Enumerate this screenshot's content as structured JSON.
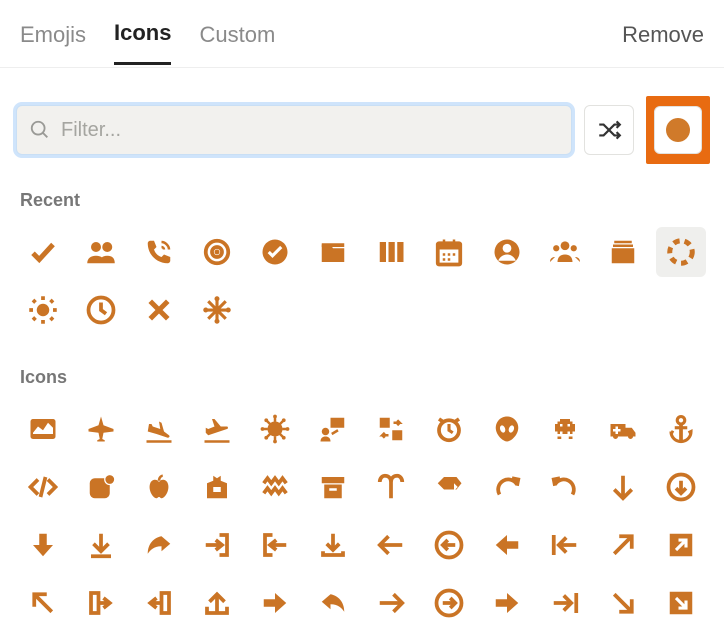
{
  "tabs": {
    "emojis": "Emojis",
    "icons": "Icons",
    "custom": "Custom",
    "active": "icons"
  },
  "remove_label": "Remove",
  "search": {
    "placeholder": "Filter...",
    "value": ""
  },
  "color": "#d07a2a",
  "sections": {
    "recent": "Recent",
    "icons": "Icons"
  },
  "recent_icons": [
    "check",
    "users",
    "phone-volume",
    "crosshair",
    "check-circle",
    "folder",
    "columns",
    "calendar",
    "user-circle",
    "users-group",
    "folder-stack",
    "dashed-circle",
    "sun",
    "clock",
    "x",
    "snowflake"
  ],
  "icons_grid": [
    "chart-area",
    "airplane",
    "plane-arrival",
    "plane-departure",
    "virus",
    "box-user",
    "box-swap",
    "alarm-clock",
    "alien",
    "space-invader",
    "ambulance",
    "anchor",
    "code",
    "app-badge",
    "apple",
    "apron",
    "aquarius",
    "archive",
    "aries",
    "direction-sign",
    "redo",
    "undo",
    "arrow-down",
    "arrow-down-circle",
    "arrow-down-bold",
    "arrow-down-to-line",
    "share-right",
    "sign-out",
    "sign-in",
    "download",
    "arrow-left",
    "arrow-left-circle",
    "arrow-left-bold",
    "arrow-left-to-line",
    "arrow-up-right",
    "arrow-up-right-box",
    "arrow-up-left",
    "exit-right",
    "exit-left",
    "upload-arrow",
    "arrow-right-bold",
    "reply",
    "arrow-right",
    "arrow-right-circle",
    "arrow-right-bold2",
    "arrow-right-to-line",
    "arrow-down-right",
    "arrow-down-right-box"
  ]
}
